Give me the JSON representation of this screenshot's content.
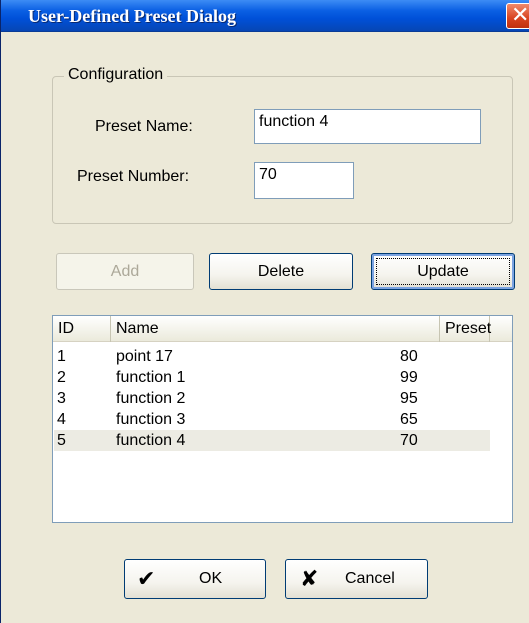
{
  "window": {
    "title": "User-Defined Preset Dialog",
    "close_icon": "close-icon"
  },
  "configuration": {
    "legend": "Configuration",
    "preset_name_label": "Preset Name:",
    "preset_name_value": "function 4",
    "preset_number_label": "Preset Number:",
    "preset_number_value": "70"
  },
  "buttons": {
    "add": "Add",
    "delete": "Delete",
    "update": "Update",
    "ok": "OK",
    "cancel": "Cancel"
  },
  "list": {
    "columns": [
      "ID",
      "Name",
      "Preset"
    ],
    "rows": [
      {
        "id": "1",
        "name": "point 17",
        "preset": "80"
      },
      {
        "id": "2",
        "name": "function 1",
        "preset": "99"
      },
      {
        "id": "3",
        "name": "function 2",
        "preset": "95"
      },
      {
        "id": "4",
        "name": "function 3",
        "preset": "65"
      },
      {
        "id": "5",
        "name": "function 4",
        "preset": "70"
      }
    ],
    "selected_row": 5
  },
  "colors": {
    "title_bar": "#0054e3",
    "dialog_bg": "#ece9d8",
    "close_button": "#d8431f",
    "selected_row": "#ecebe3"
  }
}
